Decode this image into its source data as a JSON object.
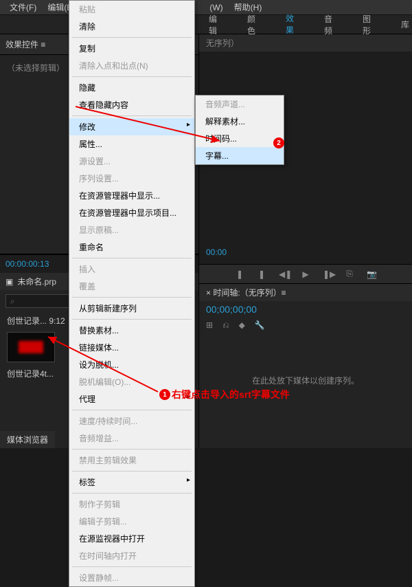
{
  "menubar": {
    "file": "文件(F)",
    "edit": "编辑(E)",
    "w": "(W)",
    "help": "帮助(H)"
  },
  "top_tabs": {
    "edit": "编辑",
    "color": "颜色",
    "effect": "效果",
    "audio": "音频",
    "graphics": "图形",
    "library": "库"
  },
  "fx_panel": {
    "title": "效果控件 ≡",
    "noclip": "（未选择剪辑）",
    "timecode": "00:00:00:13"
  },
  "project": {
    "tab": "未命名.prp",
    "search_ph": "⌕",
    "bin1": "创世记录...  9:12",
    "bin2": "创世记录4t..."
  },
  "monitor": {
    "tab": "无序列）",
    "tc": "00:00"
  },
  "timeline": {
    "tab": "× 时间轴:（无序列）≡",
    "tc": "00;00;00;00",
    "empty": "在此处放下媒体以创建序列。"
  },
  "bottom": {
    "tab": "媒体浏览器"
  },
  "menu1": {
    "paste": "粘贴",
    "clear": "清除",
    "copy": "复制",
    "inout": "清除入点和出点(N)",
    "hide": "隐藏",
    "showhidden": "查看隐藏内容",
    "modify": "修改",
    "props": "属性...",
    "srcset": "源设置...",
    "seqset": "序列设置...",
    "reveal": "在资源管理器中显示...",
    "revealproj": "在资源管理器中显示项目...",
    "showorig": "显示原稿...",
    "rename": "重命名",
    "insert": "插入",
    "overwrite": "覆盖",
    "newseq": "从剪辑新建序列",
    "replace": "替换素材...",
    "link": "链接媒体...",
    "offline": "设为脱机...",
    "proxy": "脱机编辑(O)...",
    "proxy2": "代理",
    "speed": "速度/持续时间...",
    "gain": "音频增益...",
    "disablefx": "禁用主剪辑效果",
    "label": "标签",
    "subseq": "制作子剪辑",
    "editsub": "编辑子剪辑...",
    "opensrc": "在源监视器中打开",
    "opentl": "在时间轴内打开",
    "setposter": "设置静帧..."
  },
  "menu2": {
    "chan": "音频声道...",
    "interp": "解释素材...",
    "tc": "时间码...",
    "caption": "字幕..."
  },
  "callout": {
    "text": "右键点击导入的srt字幕文件"
  }
}
